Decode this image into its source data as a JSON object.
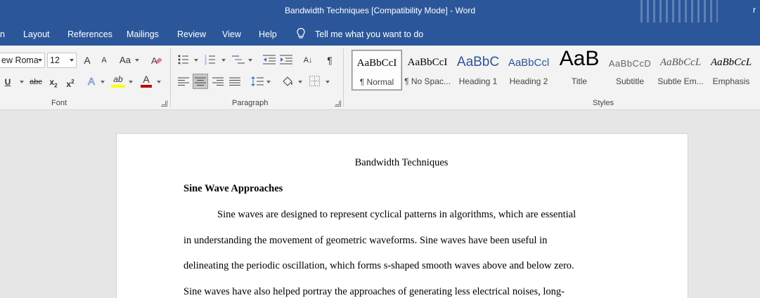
{
  "window": {
    "title": "Bandwidth Techniques [Compatibility Mode]  -  Word",
    "account_fragment": "r"
  },
  "tabs": [
    {
      "label": "n"
    },
    {
      "label": "Layout"
    },
    {
      "label": "References"
    },
    {
      "label": "Mailings"
    },
    {
      "label": "Review"
    },
    {
      "label": "View"
    },
    {
      "label": "Help"
    }
  ],
  "tell_me": {
    "label": "Tell me what you want to do"
  },
  "font_group": {
    "font_name": "ew Roma",
    "font_size": "12",
    "grow_label": "A",
    "shrink_label": "A",
    "case_label": "Aa",
    "underline_label": "U",
    "strike_label": "abc",
    "subscript_label": "x",
    "subscript_mark": "2",
    "superscript_label": "x",
    "superscript_mark": "2",
    "effects_label": "A",
    "highlight_label": "ab",
    "color_label": "A",
    "label": "Font"
  },
  "paragraph_group": {
    "sort_label": "A↓",
    "pilcrow_label": "¶",
    "label": "Paragraph"
  },
  "styles_group": {
    "label": "Styles",
    "items": [
      {
        "preview": "AaBbCcI",
        "name": "¶ Normal"
      },
      {
        "preview": "AaBbCcI",
        "name": "¶ No Spac..."
      },
      {
        "preview": "AaBbC",
        "name": "Heading 1"
      },
      {
        "preview": "AaBbCcl",
        "name": "Heading 2"
      },
      {
        "preview": "AaB",
        "name": "Title"
      },
      {
        "preview": "AaBbCcD",
        "name": "Subtitle"
      },
      {
        "preview": "AaBbCcL",
        "name": "Subtle Em..."
      },
      {
        "preview": "AaBbCcL",
        "name": "Emphasis"
      }
    ]
  },
  "colors": {
    "accent": "#2b579a",
    "highlight": "#ffff00",
    "font_color": "#c00000"
  },
  "document": {
    "title": "Bandwidth Techniques",
    "heading": "Sine Wave Approaches",
    "lines": [
      "Sine waves are designed to represent cyclical patterns in algorithms, which are essential",
      "in understanding the movement of geometric waveforms. Sine waves have been useful in",
      "delineating the periodic oscillation, which forms s-shaped smooth waves above and below zero.",
      "Sine waves have also helped portray the approaches of generating less electrical noises, long-"
    ]
  }
}
